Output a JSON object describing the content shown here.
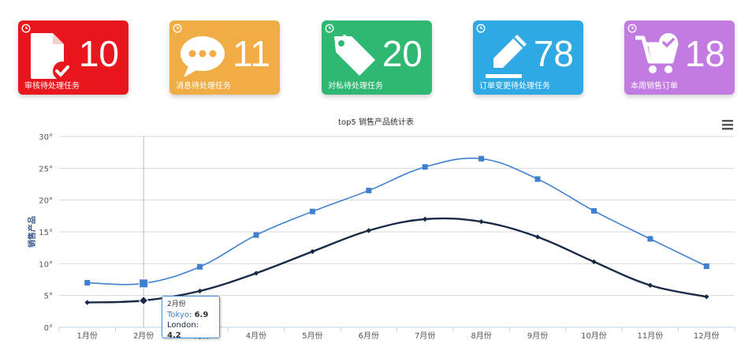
{
  "cards": [
    {
      "count": "10",
      "label": "审核待处理任务",
      "color": "#e8161d",
      "icon": "document-check-icon"
    },
    {
      "count": "11",
      "label": "消息待处理任务",
      "color": "#f0ad46",
      "icon": "chat-bubble-icon"
    },
    {
      "count": "20",
      "label": "对私待处理任务",
      "color": "#2eb872",
      "icon": "tags-icon"
    },
    {
      "count": "78",
      "label": "订单变更待处理任务",
      "color": "#2ea9e3",
      "icon": "pencil-icon"
    },
    {
      "count": "18",
      "label": "本周销售订单",
      "color": "#c27be0",
      "icon": "cart-check-icon"
    }
  ],
  "chart_data": {
    "type": "line",
    "title": "top5 销售产品统计表",
    "xlabel": "",
    "ylabel": "销售产品",
    "categories": [
      "1月份",
      "2月份",
      "3月份",
      "4月份",
      "5月份",
      "6月份",
      "7月份",
      "8月份",
      "9月份",
      "10月份",
      "11月份",
      "12月份"
    ],
    "y_ticks": [
      "0°",
      "5°",
      "10°",
      "15°",
      "20°",
      "25°",
      "30°"
    ],
    "ylim": [
      0,
      30
    ],
    "grid": true,
    "smooth": true,
    "series": [
      {
        "name": "Tokyo",
        "color": "#3f7fcf",
        "marker": "square",
        "values": [
          7.0,
          6.9,
          9.5,
          14.5,
          18.2,
          21.5,
          25.2,
          26.5,
          23.3,
          18.3,
          13.9,
          9.6
        ]
      },
      {
        "name": "London",
        "color": "#182a45",
        "marker": "diamond",
        "values": [
          3.9,
          4.2,
          5.7,
          8.5,
          11.9,
          15.2,
          17.0,
          16.6,
          14.2,
          10.3,
          6.6,
          4.8
        ]
      }
    ],
    "tooltip": {
      "category": "2月份",
      "index": 1
    }
  },
  "menu_icon": "hamburger-menu-icon"
}
